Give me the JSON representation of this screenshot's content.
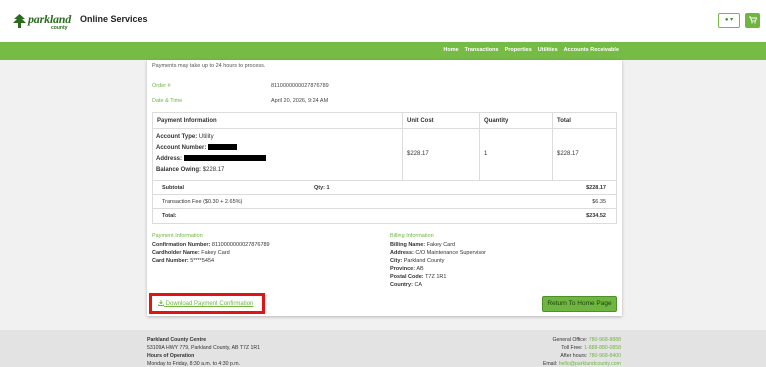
{
  "header": {
    "logo_text": "parkland",
    "logo_sub": "county",
    "site_title": "Online Services",
    "user_icon": "user-icon",
    "cart_icon": "cart-icon"
  },
  "nav": {
    "items": [
      "Home",
      "Transactions",
      "Properties",
      "Utilities",
      "Accounts Receivable"
    ]
  },
  "receipt": {
    "notice": "Payments may take up to 24 hours to process.",
    "order_label": "Order #",
    "order_value": "8110000000027876789",
    "date_label": "Date & Time",
    "date_value": "April 20, 2026, 9:24 AM",
    "table": {
      "headers": [
        "Payment Information",
        "Unit Cost",
        "Quantity",
        "Total"
      ],
      "account_type_label": "Account Type:",
      "account_type_value": "Utility",
      "account_number_label": "Account Number:",
      "address_label": "Address:",
      "balance_label": "Balance Owing:",
      "balance_value": "$228.17",
      "unit_cost": "$228.17",
      "quantity": "1",
      "total": "$228.17",
      "subtotal_label": "Subtotal",
      "subtotal_qty": "Qty: 1",
      "subtotal_value": "$228.17",
      "fee_label": "Transaction Fee ($0.30 + 2.65%)",
      "fee_value": "$6.35",
      "grand_label": "Total:",
      "grand_value": "$234.52"
    },
    "payment_info": {
      "title": "Payment Information",
      "confirmation_label": "Confirmation Number:",
      "confirmation_value": "8110000000027876789",
      "cardholder_label": "Cardholder Name:",
      "cardholder_value": "Fakey Card",
      "card_label": "Card Number:",
      "card_value": "5****5454"
    },
    "billing_info": {
      "title": "Billing Information",
      "name_label": "Billing Name:",
      "name_value": "Fakey Card",
      "address_label": "Address:",
      "address_value": "C/O Maintenance Supervisor",
      "city_label": "City:",
      "city_value": "Parkland County",
      "province_label": "Province:",
      "province_value": "AB",
      "postal_label": "Postal Code:",
      "postal_value": "T7Z 1R1",
      "country_label": "Country:",
      "country_value": "CA"
    },
    "download_label": "Download Payment Confirmation",
    "download_icon": "download-icon",
    "home_button": "Return To Home Page"
  },
  "footer": {
    "org_name": "Parkland County Centre",
    "org_address": "53109A HWY 779, Parkland County, AB T7Z 1R1",
    "hours_title": "Hours of Operation",
    "hours_value": "Monday to Friday, 8:30 a.m. to 4:30 p.m.",
    "general_label": "General Office:",
    "general_value": "780-968-8888",
    "tollfree_label": "Toll Free:",
    "tollfree_value": "1-888-880-0858",
    "afterhours_label": "After hours:",
    "afterhours_value": "780-968-8400",
    "email_label": "Email:",
    "email_value": "hello@parklandcounty.com"
  },
  "colors": {
    "brand_green": "#77bb47",
    "highlight_red": "#e01414"
  }
}
